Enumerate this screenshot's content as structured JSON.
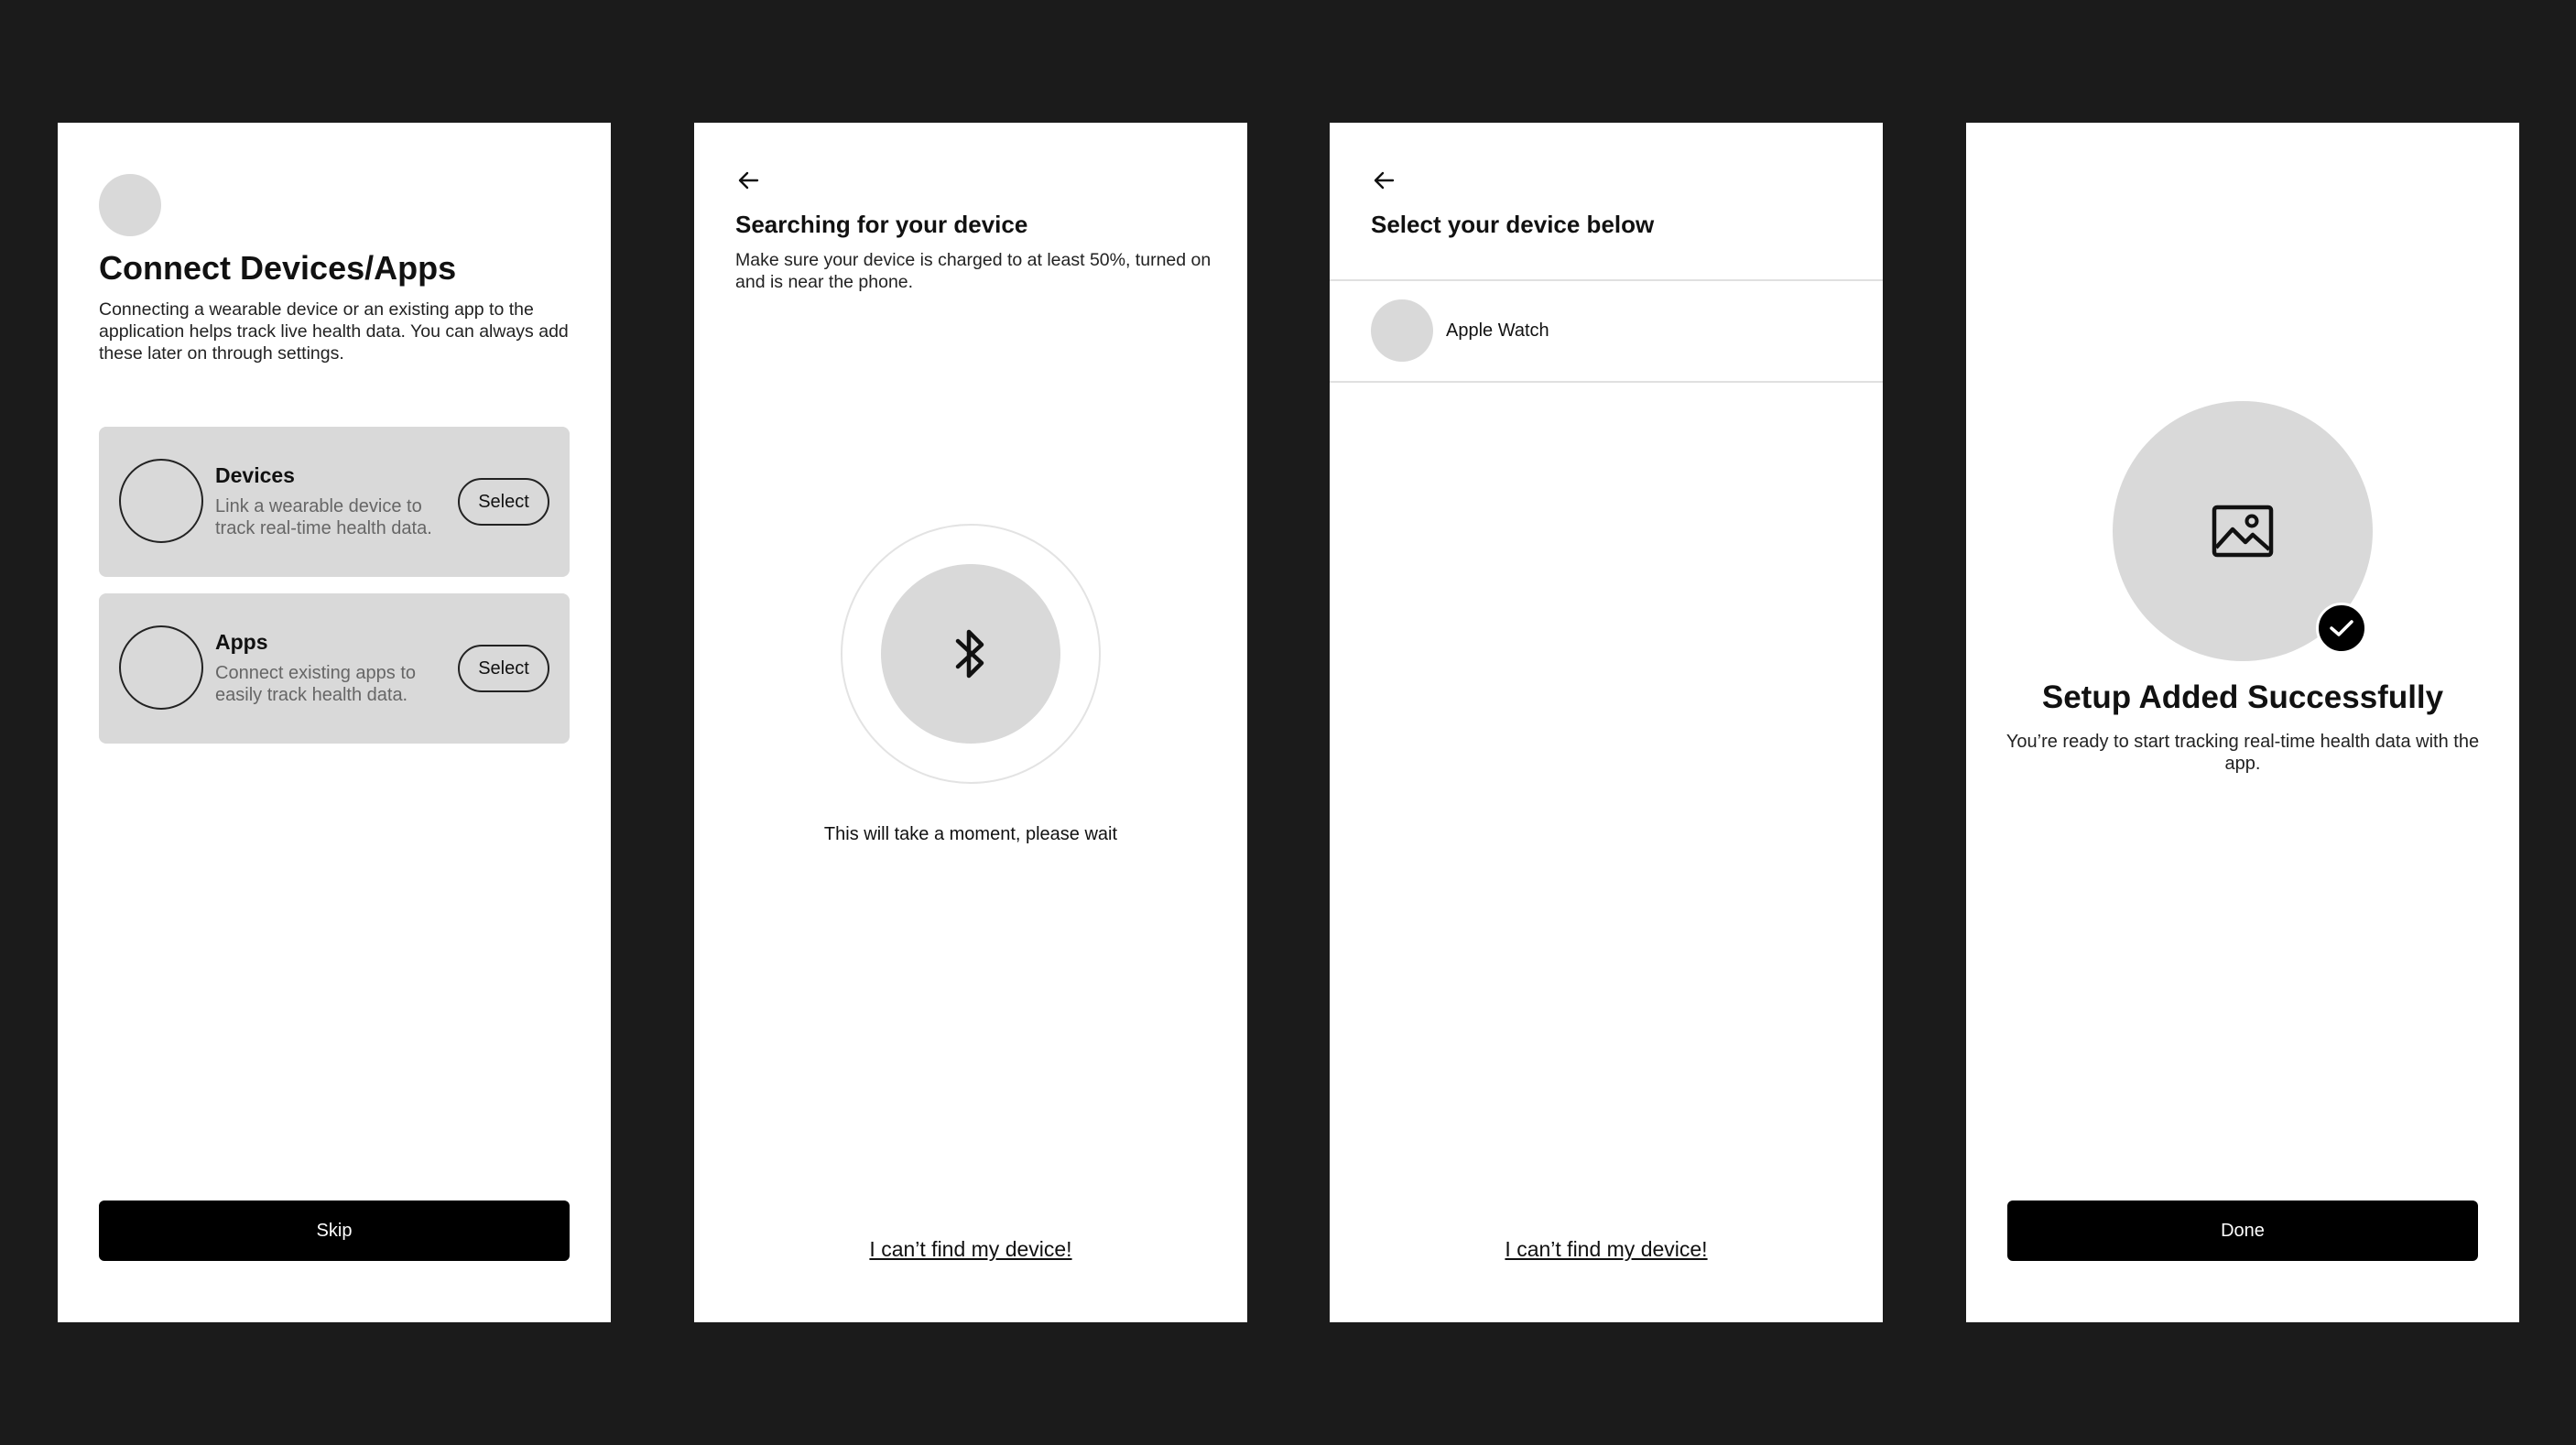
{
  "connect_screen": {
    "title": "Connect Devices/Apps",
    "description": "Connecting a wearable device or an existing app to the application helps track live health data. You can always add these later on through settings.",
    "options": [
      {
        "title": "Devices",
        "description": "Link a wearable device to track real-time health data.",
        "button_label": "Select"
      },
      {
        "title": "Apps",
        "description": "Connect existing apps to easily track health data.",
        "button_label": "Select"
      }
    ],
    "skip_label": "Skip"
  },
  "searching_screen": {
    "title": "Searching for your device",
    "description": "Make sure your device is charged to at least 50%, turned on and is near the phone.",
    "icon": "bluetooth-icon",
    "wait_text": "This will take a moment, please wait",
    "cant_find_label": "I can’t find my device!"
  },
  "select_screen": {
    "title": "Select your device below",
    "devices": [
      {
        "name": "Apple Watch"
      }
    ],
    "cant_find_label": "I can’t find my device!"
  },
  "success_screen": {
    "icon": "image-placeholder-icon",
    "badge_icon": "checkmark-icon",
    "title": "Setup Added Successfully",
    "description": "You’re ready to start tracking real-time health data with the app.",
    "done_label": "Done"
  },
  "colors": {
    "background": "#1b1b1b",
    "screen": "#ffffff",
    "placeholder": "#d9d9d9",
    "primary_button": "#000000"
  }
}
